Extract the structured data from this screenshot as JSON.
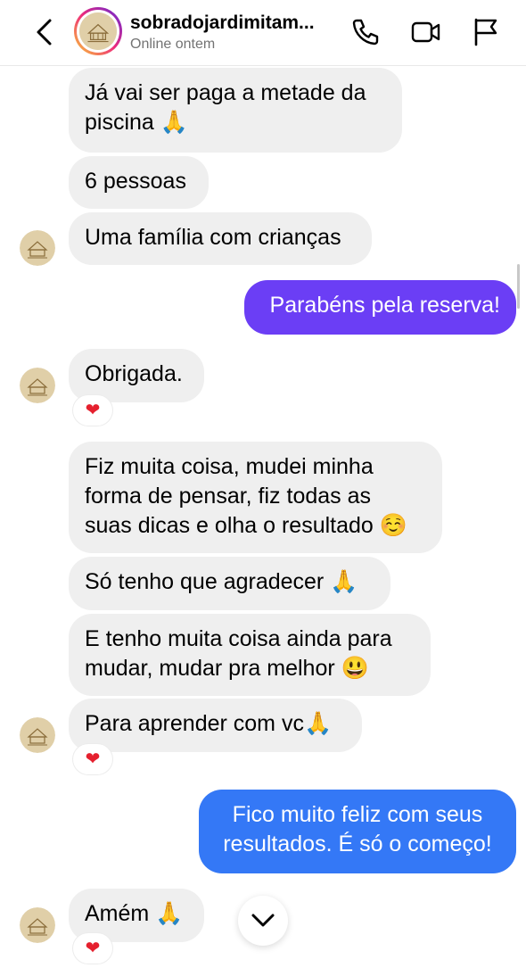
{
  "header": {
    "title": "sobradojardimitam...",
    "status": "Online ontem"
  },
  "messages": [
    {
      "dir": "in",
      "text": "Já vai ser paga a metade da\npiscina 🙏"
    },
    {
      "dir": "in",
      "text": "6 pessoas"
    },
    {
      "dir": "in",
      "text": "Uma família com crianças"
    },
    {
      "dir": "out",
      "text": "Parabéns pela reserva!"
    },
    {
      "dir": "in",
      "text": "Obrigada.",
      "reaction": "❤"
    },
    {
      "dir": "in",
      "text": "Fiz muita coisa, mudei minha\nforma de pensar, fiz todas as\nsuas dicas e olha o resultado ☺️"
    },
    {
      "dir": "in",
      "text": "Só tenho que agradecer 🙏"
    },
    {
      "dir": "in",
      "text": "E tenho muita coisa ainda para\nmudar, mudar pra melhor 😃"
    },
    {
      "dir": "in",
      "text": "Para aprender com vc🙏",
      "reaction": "❤"
    },
    {
      "dir": "out",
      "text": "Fico muito feliz com seus\nresultados. É só o começo!"
    },
    {
      "dir": "in",
      "text": "Amém 🙏",
      "reaction": "❤"
    }
  ],
  "colors": {
    "incoming_bubble": "#efefef",
    "outgoing_purple": "#6b3ef5",
    "outgoing_blue": "#3478f6",
    "reaction_heart": "#e5202e"
  },
  "icons": [
    "back-icon",
    "phone-icon",
    "video-icon",
    "flag-icon",
    "heart-icon",
    "chevron-down-icon"
  ]
}
